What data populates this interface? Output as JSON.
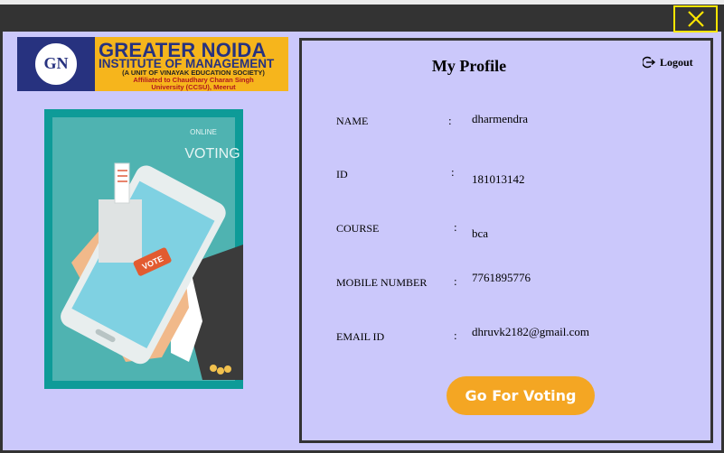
{
  "window": {
    "close_icon": "close-x-icon",
    "accent_color": "#ffe600"
  },
  "logo": {
    "emblem_text": "GN",
    "line1": "GREATER NOIDA",
    "line2": "INSTITUTE OF MANAGEMENT",
    "line3": "(A UNIT OF VINAYAK EDUCATION SOCIETY)",
    "line4": "Affiliated to Chaudhary Charan Singh",
    "line5": "University (CCSU), Meerut"
  },
  "illustration": {
    "online_label": "ONLINE",
    "voting_label": "VOTING",
    "vote_label": "VOTE"
  },
  "profile": {
    "title": "My Profile",
    "logout_label": "Logout",
    "logout_icon": "logout-icon",
    "fields": [
      {
        "label": "NAME",
        "value": "dharmendra"
      },
      {
        "label": "ID",
        "value": "181013142"
      },
      {
        "label": "COURSE",
        "value": "bca"
      },
      {
        "label": "MOBILE NUMBER",
        "value": "7761895776"
      },
      {
        "label": "EMAIL ID",
        "value": "dhruvk2182@gmail.com"
      }
    ],
    "colon": ":",
    "vote_button_label": "Go For Voting",
    "vote_button_color": "#f4a623"
  }
}
